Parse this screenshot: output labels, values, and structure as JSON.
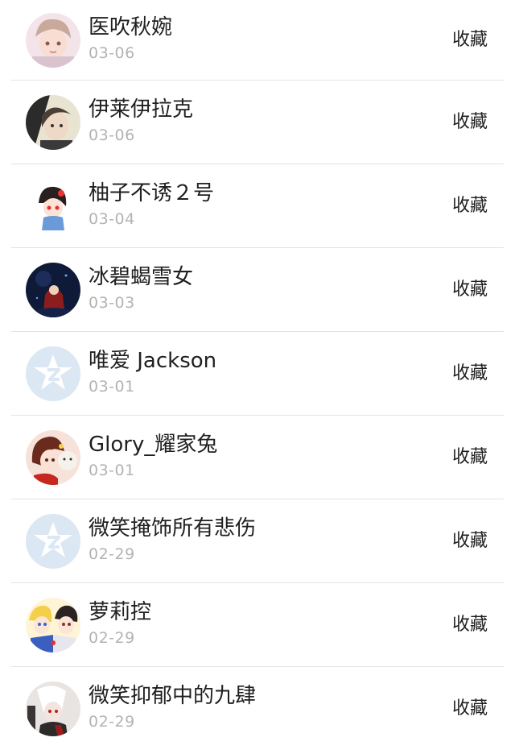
{
  "favorites": {
    "action_label": "收藏",
    "items": [
      {
        "name": "医吹秋婉",
        "date": "03-06",
        "avatar": "anime-girl-avatar"
      },
      {
        "name": "伊莱伊拉克",
        "date": "03-06",
        "avatar": "anime-boy-avatar"
      },
      {
        "name": "柚子不诱２号",
        "date": "03-04",
        "avatar": "chibi-girl-avatar"
      },
      {
        "name": "冰碧蝎雪女",
        "date": "03-03",
        "avatar": "dark-scene-avatar"
      },
      {
        "name": "唯爱 Jackson",
        "date": "03-01",
        "avatar": "default-qzone-avatar"
      },
      {
        "name": "Glory_耀家兔",
        "date": "03-01",
        "avatar": "anime-girl-bunny-avatar"
      },
      {
        "name": "微笑掩饰所有悲伤",
        "date": "02-29",
        "avatar": "default-qzone-avatar"
      },
      {
        "name": "萝莉控",
        "date": "02-29",
        "avatar": "anime-duo-avatar"
      },
      {
        "name": "微笑抑郁中的九肆",
        "date": "02-29",
        "avatar": "anime-dark-avatar"
      }
    ]
  }
}
